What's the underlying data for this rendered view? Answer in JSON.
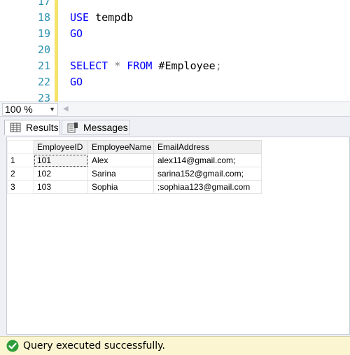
{
  "editor": {
    "lines": [
      {
        "number": "17",
        "tokens": []
      },
      {
        "number": "18",
        "tokens": [
          {
            "t": "USE",
            "c": "kw"
          },
          {
            "t": " tempdb",
            "c": "pl"
          }
        ]
      },
      {
        "number": "19",
        "tokens": [
          {
            "t": "GO",
            "c": "kw"
          }
        ]
      },
      {
        "number": "20",
        "tokens": []
      },
      {
        "number": "21",
        "tokens": [
          {
            "t": "SELECT",
            "c": "kw"
          },
          {
            "t": " * ",
            "c": "op"
          },
          {
            "t": "FROM",
            "c": "kw"
          },
          {
            "t": " #Employee",
            "c": "pl"
          },
          {
            "t": ";",
            "c": "op"
          }
        ]
      },
      {
        "number": "22",
        "tokens": [
          {
            "t": "GO",
            "c": "kw"
          }
        ]
      },
      {
        "number": "23",
        "tokens": []
      }
    ]
  },
  "zoom": {
    "value": "100 %",
    "arrow": "▼",
    "scroll_left": "◀"
  },
  "tabs": {
    "results": "Results",
    "messages": "Messages"
  },
  "grid": {
    "columns": [
      "EmployeeID",
      "EmployeeName",
      "EmailAddress"
    ],
    "rows": [
      {
        "num": "1",
        "cells": [
          "101",
          "Alex",
          "alex114@gmail.com;"
        ]
      },
      {
        "num": "2",
        "cells": [
          "102",
          "Sarina",
          "sarina152@gmail.com;"
        ]
      },
      {
        "num": "3",
        "cells": [
          "103",
          "Sophia",
          ";sophiaa123@gmail.com"
        ]
      }
    ]
  },
  "status": {
    "text": "Query executed successfully.",
    "icon": "check-circle-icon",
    "color": "#2e9e3a"
  },
  "colors": {
    "keyword": "#0000ff",
    "line_number": "#2b91af",
    "change_bar": "#f4e36a",
    "status_bg": "#fbf5d1"
  }
}
